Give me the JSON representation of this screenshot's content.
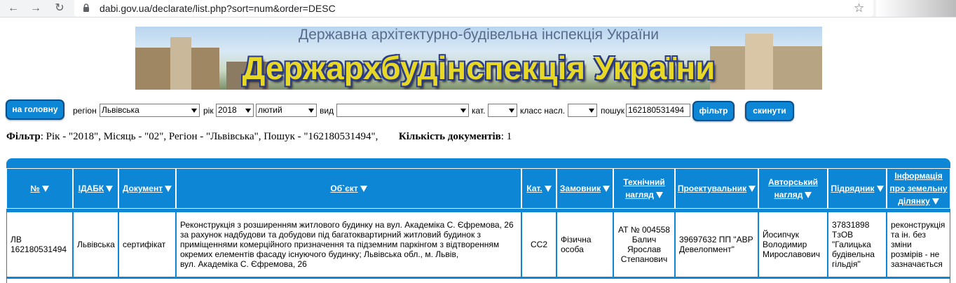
{
  "browser": {
    "url": "dabi.gov.ua/declarate/list.php?sort=num&order=DESC"
  },
  "banner": {
    "subtitle": "Державна архітектурно-будівельна інспекція України",
    "title": "Держархбудінспекція України"
  },
  "toolbar": {
    "home_button": "на головну",
    "region_label": "регіон",
    "region_value": "Львівська",
    "year_label": "рік",
    "year_value": "2018",
    "month_value": "лютий",
    "type_label": "вид",
    "type_value": "",
    "cat_label": "кат.",
    "cat_value": "",
    "class_label": "класс насл.",
    "class_value": "",
    "search_label": "пошук",
    "search_value": "162180531494",
    "filter_button": "фільтр",
    "reset_button": "скинути"
  },
  "summary": {
    "filter_label": "Фільтр",
    "filter_text": ": Рік - \"2018\", Місяць - \"02\", Регіон - \"Львівська\", Пошук - \"162180531494\",",
    "count_label": "Кількість документів",
    "count_text": ": 1"
  },
  "table": {
    "headers": {
      "num": "№",
      "idabk": "ІДАБК",
      "doc": "Документ",
      "object": "Об`єкт",
      "cat": "Кат.",
      "customer": "Замовник",
      "tech1": "Технічний",
      "tech2": "нагляд",
      "designer": "Проектувальник",
      "author1": "Авторський",
      "author2": "нагляд",
      "contractor": "Підрядник",
      "land1": "Інформація",
      "land2": "про земельну",
      "land3": "ділянку"
    },
    "row": {
      "num1": "ЛВ",
      "num2": "162180531494",
      "idabk": "Львівська",
      "doc": "сертифікат",
      "object1": "Реконструкція з розширенням житлового будинку на вул. Академіка С. Єфремова, 26",
      "object2": "за рахунок надбудови та добудови під багатоквартирний житловий будинок з",
      "object3": "приміщеннями комерційного призначення та підземним паркінгом з відтворенням",
      "object4": "окремих елементів фасаду існуючого будинку; Львівська обл., м. Львів,",
      "object5": "вул. Академіка С. Єфремова, 26",
      "cat": "СС2",
      "customer1": "Фізична",
      "customer2": "особа",
      "tech1": "АТ № 004558",
      "tech2": "Балич",
      "tech3": "Ярослав",
      "tech4": "Степанович",
      "designer1": "39697632 ПП \"АВР",
      "designer2": "Девелопмент\"",
      "author1": "Йосипчук",
      "author2": "Володимир",
      "author3": "Мирославович",
      "contractor1": "37831898",
      "contractor2": "ТзОВ",
      "contractor3": "\"Галицька",
      "contractor4": "будівельна",
      "contractor5": "гільдія\"",
      "land1": "реконструкція",
      "land2": "та ін. без",
      "land3": "зміни",
      "land4": "розмірів - не",
      "land5": "зазначається"
    }
  }
}
